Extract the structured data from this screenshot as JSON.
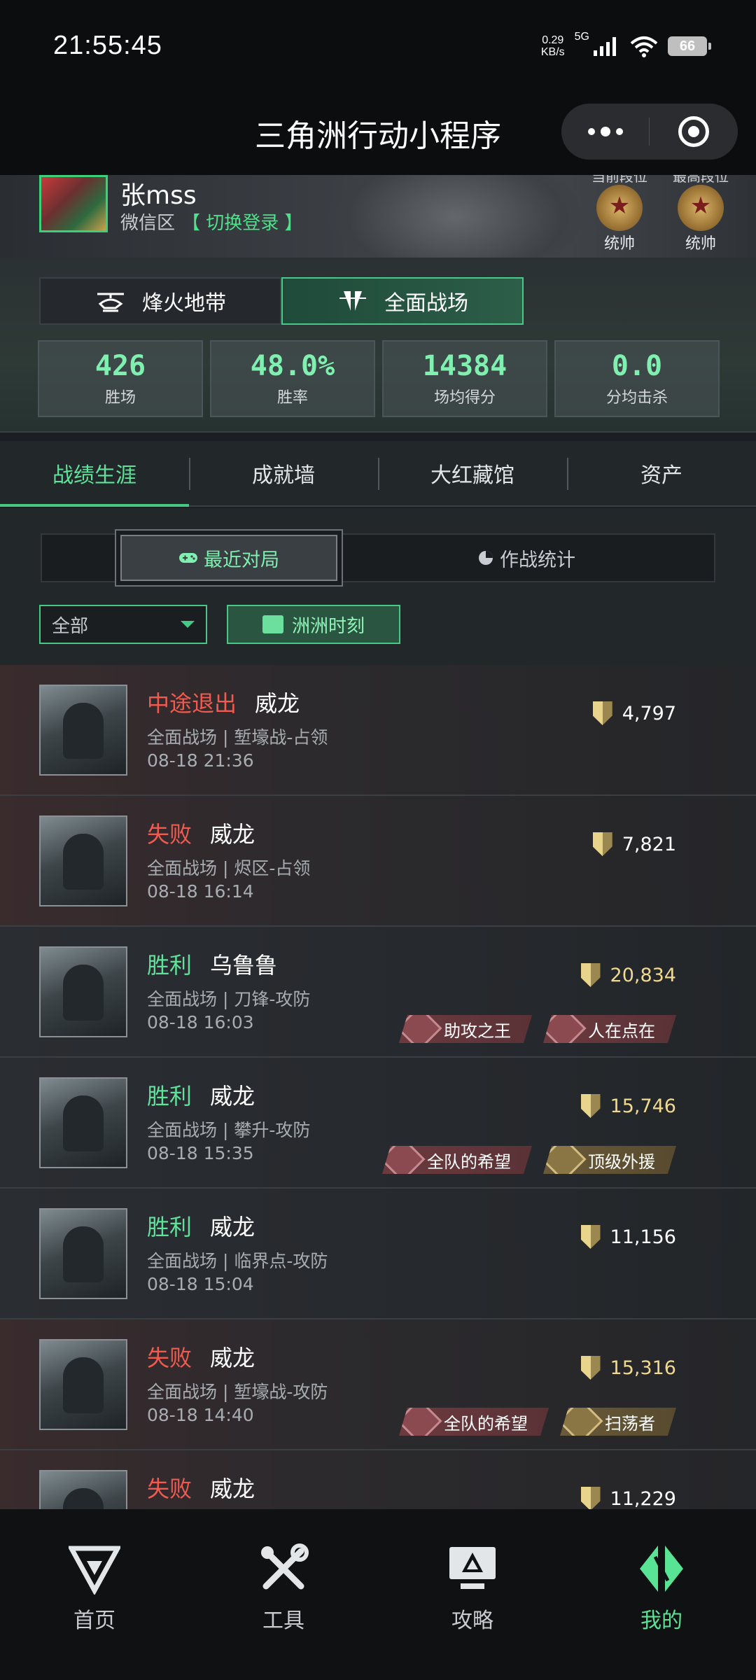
{
  "status_bar": {
    "time": "21:55:45",
    "speed_value": "0.29",
    "speed_unit": "KB/s",
    "network": "5G",
    "battery": "66"
  },
  "header": {
    "title": "三角洲行动小程序"
  },
  "profile": {
    "name": "张mss",
    "region": "微信区",
    "switch_login": "【 切换登录 】",
    "ranks": [
      {
        "caption": "当前段位",
        "label": "统帅"
      },
      {
        "caption": "最高段位",
        "label": "统帅"
      }
    ]
  },
  "mode_tabs": [
    {
      "label": "烽火地带",
      "icon": "helicopter-icon"
    },
    {
      "label": "全面战场",
      "icon": "warfare-icon",
      "active": true
    }
  ],
  "stats": [
    {
      "value": "426",
      "label": "胜场"
    },
    {
      "value": "48.0%",
      "label": "胜率"
    },
    {
      "value": "14384",
      "label": "场均得分"
    },
    {
      "value": "0.0",
      "label": "分均击杀"
    }
  ],
  "main_tabs": [
    {
      "label": "战绩生涯",
      "active": true
    },
    {
      "label": "成就墙"
    },
    {
      "label": "大红藏馆"
    },
    {
      "label": "资产"
    }
  ],
  "segments": {
    "recent": "最近对局",
    "stats": "作战统计"
  },
  "filters": {
    "select_value": "全部",
    "moment": "洲洲时刻"
  },
  "matches": [
    {
      "result": "中途退出",
      "result_type": "lose",
      "operator": "威龙",
      "mode": "全面战场 | 堑壕战-占领",
      "time": "08-18 21:36",
      "score": "4,797",
      "tags": []
    },
    {
      "result": "失败",
      "result_type": "lose",
      "operator": "威龙",
      "mode": "全面战场 | 烬区-占领",
      "time": "08-18 16:14",
      "score": "7,821",
      "tags": []
    },
    {
      "result": "胜利",
      "result_type": "win",
      "operator": "乌鲁鲁",
      "mode": "全面战场 | 刀锋-攻防",
      "time": "08-18 16:03",
      "score": "20,834",
      "tags": [
        {
          "label": "助攻之王",
          "style": "red"
        },
        {
          "label": "人在点在",
          "style": "red"
        }
      ]
    },
    {
      "result": "胜利",
      "result_type": "win",
      "operator": "威龙",
      "mode": "全面战场 | 攀升-攻防",
      "time": "08-18 15:35",
      "score": "15,746",
      "tags": [
        {
          "label": "全队的希望",
          "style": "red"
        },
        {
          "label": "顶级外援",
          "style": "gold"
        }
      ]
    },
    {
      "result": "胜利",
      "result_type": "win",
      "operator": "威龙",
      "mode": "全面战场 | 临界点-攻防",
      "time": "08-18 15:04",
      "score": "11,156",
      "tags": []
    },
    {
      "result": "失败",
      "result_type": "lose",
      "operator": "威龙",
      "mode": "全面战场 | 堑壕战-攻防",
      "time": "08-18 14:40",
      "score": "15,316",
      "tags": [
        {
          "label": "全队的希望",
          "style": "red"
        },
        {
          "label": "扫荡者",
          "style": "gold"
        }
      ]
    },
    {
      "result": "失败",
      "result_type": "lose",
      "operator": "威龙",
      "mode": "",
      "time": "",
      "score": "11,229",
      "tags": []
    }
  ],
  "bottom_nav": [
    {
      "label": "首页",
      "icon": "home-logo-icon"
    },
    {
      "label": "工具",
      "icon": "tools-icon"
    },
    {
      "label": "攻略",
      "icon": "guide-monitor-icon"
    },
    {
      "label": "我的",
      "icon": "profile-logo-icon",
      "active": true
    }
  ],
  "colors": {
    "accent": "#45c982",
    "win": "#5fe39a",
    "lose": "#f05a4f",
    "score_gold": "#f0d98f"
  }
}
